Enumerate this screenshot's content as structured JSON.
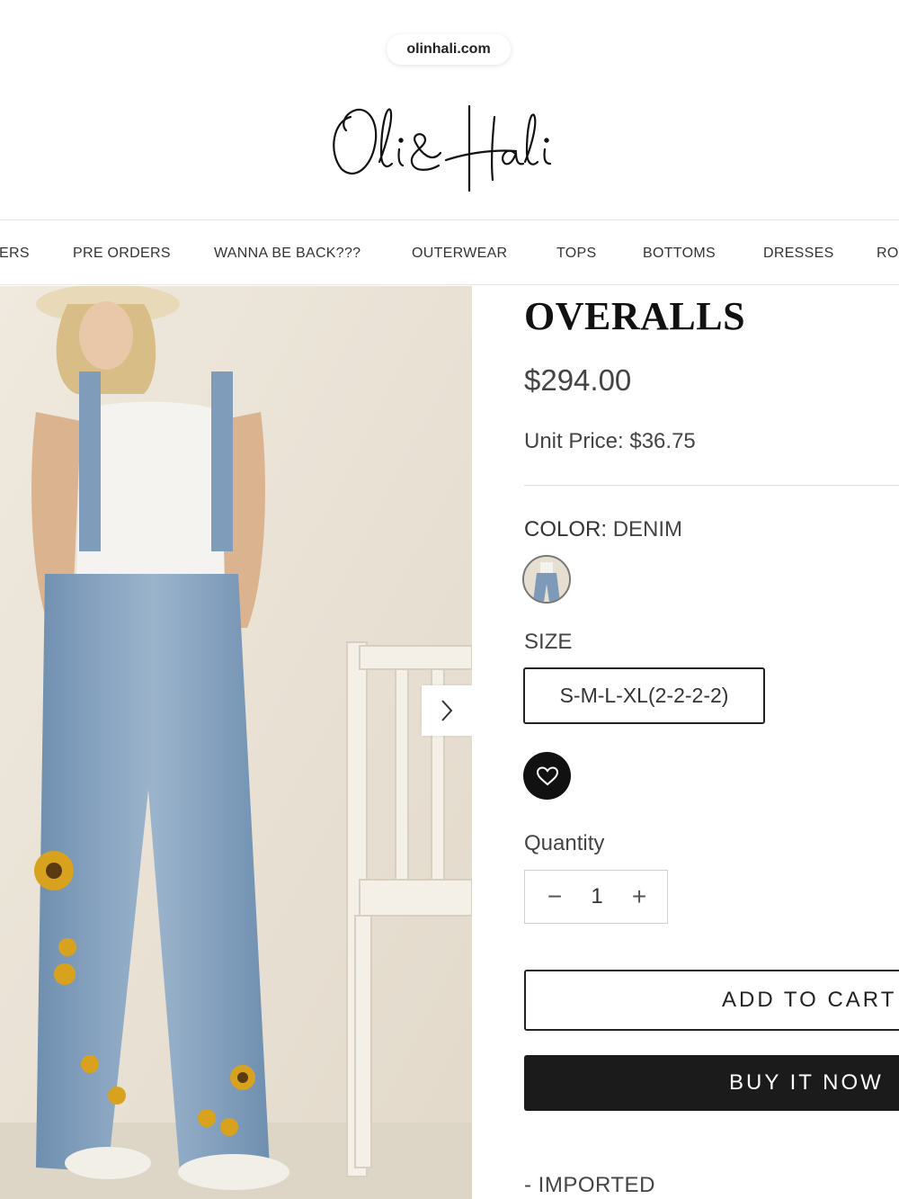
{
  "browser": {
    "url": "olinhali.com"
  },
  "brand": {
    "logo_text": "Oli & Hali"
  },
  "nav": {
    "items": [
      "ERS",
      "PRE ORDERS",
      "WANNA BE BACK???",
      "OUTERWEAR",
      "TOPS",
      "BOTTOMS",
      "DRESSES",
      "RO"
    ]
  },
  "product": {
    "title": "OVERALLS",
    "price": "$294.00",
    "unit_price": "Unit Price: $36.75",
    "color_key": "COLOR:",
    "color_value": "DENIM",
    "size_label": "SIZE",
    "size_option": "S-M-L-XL(2-2-2-2)",
    "quantity_label": "Quantity",
    "quantity_value": "1",
    "quantity_minus": "−",
    "quantity_plus": "+",
    "add_to_cart": "ADD TO CART",
    "buy_now": "BUY IT NOW",
    "details": "- IMPORTED"
  },
  "icons": {
    "next": "chevron-right-icon",
    "wishlist": "heart-icon"
  },
  "colors": {
    "buy_now_bg": "#1b1b1b",
    "image_wall": "#e9e2d5",
    "denim": "#7d9ab8"
  }
}
